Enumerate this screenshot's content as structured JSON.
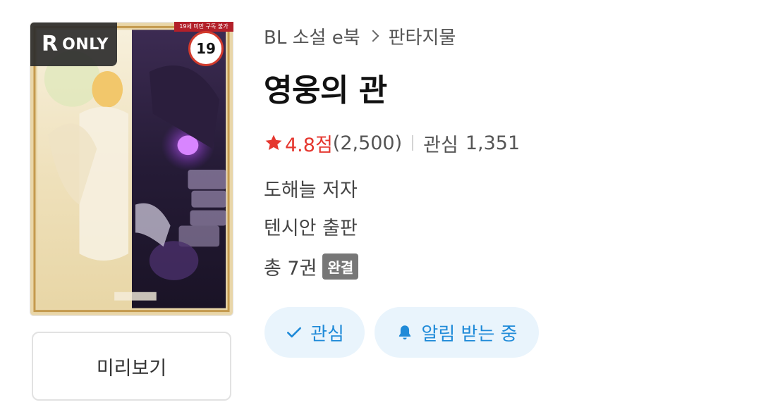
{
  "cover": {
    "badge_r": "R",
    "badge_only": "ONLY",
    "age_rating": "19",
    "top_tag": "19세 미만 구독 불가"
  },
  "preview_button": {
    "label": "미리보기"
  },
  "breadcrumb": {
    "category": "BL 소설 e북",
    "genre": "판타지물"
  },
  "title": "영웅의 관",
  "rating": {
    "score": "4.8점",
    "count": "(2,500)"
  },
  "interest": {
    "label": "관심",
    "count": "1,351"
  },
  "author": "도해늘 저자",
  "publisher": "텐시안 출판",
  "volumes": {
    "text": "총 7권",
    "status_badge": "완결"
  },
  "actions": {
    "interest_label": "관심",
    "alarm_label": "알림 받는 중"
  },
  "colors": {
    "accent_blue": "#1f8ad8",
    "pill_bg": "#e9f4fc",
    "star_red": "#e5372f",
    "age_ring": "#d23a2c"
  }
}
